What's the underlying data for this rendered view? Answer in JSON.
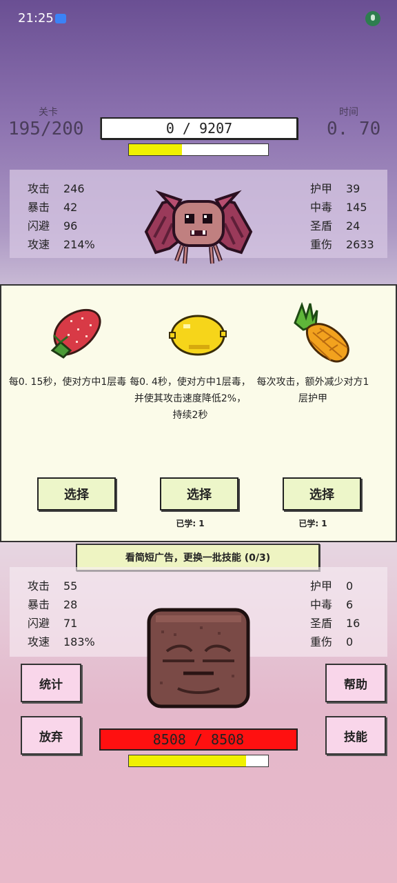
{
  "status_bar": {
    "time": "21:25"
  },
  "header": {
    "level_label": "关卡",
    "level_value": "195/200",
    "time_label": "时间",
    "time_value": "0. 70",
    "enemy_hp_text": "0  /  9207",
    "enemy_attack_progress": 0.38
  },
  "enemy_stats": {
    "left": [
      {
        "label": "攻击",
        "value": "246"
      },
      {
        "label": "暴击",
        "value": "42"
      },
      {
        "label": "闪避",
        "value": "96"
      },
      {
        "label": "攻速",
        "value": "214%"
      }
    ],
    "right": [
      {
        "label": "护甲",
        "value": "39"
      },
      {
        "label": "中毒",
        "value": "145"
      },
      {
        "label": "圣盾",
        "value": "24"
      },
      {
        "label": "重伤",
        "value": "2633"
      }
    ]
  },
  "skills": [
    {
      "icon": "strawberry-icon",
      "desc": "每0. 15秒，使对方中1层毒",
      "button": "选择",
      "learned": ""
    },
    {
      "icon": "lemon-icon",
      "desc": "每0. 4秒，使对方中1层毒，并使其攻击速度降低2%，持续2秒",
      "button": "选择",
      "learned": "已学: 1"
    },
    {
      "icon": "pineapple-icon",
      "desc": "每次攻击，额外减少对方1层护甲",
      "button": "选择",
      "learned": "已学: 1"
    }
  ],
  "ad_banner": "看简短广告，更换一批技能 (0/3)",
  "player_stats": {
    "left": [
      {
        "label": "攻击",
        "value": "55"
      },
      {
        "label": "暴击",
        "value": "28"
      },
      {
        "label": "闪避",
        "value": "71"
      },
      {
        "label": "攻速",
        "value": "183%"
      }
    ],
    "right": [
      {
        "label": "护甲",
        "value": "0"
      },
      {
        "label": "中毒",
        "value": "6"
      },
      {
        "label": "圣盾",
        "value": "16"
      },
      {
        "label": "重伤",
        "value": "0"
      }
    ]
  },
  "buttons": {
    "stats": "统计",
    "give_up": "放弃",
    "help": "帮助",
    "skills": "技能"
  },
  "player": {
    "hp_text": "8508  /  8508",
    "attack_progress": 0.84
  },
  "colors": {
    "hp_red": "#ff1010",
    "atb_yellow": "#f0f000",
    "card_bg": "#fbfbe9",
    "side_button_bg": "#f9d6ea"
  }
}
